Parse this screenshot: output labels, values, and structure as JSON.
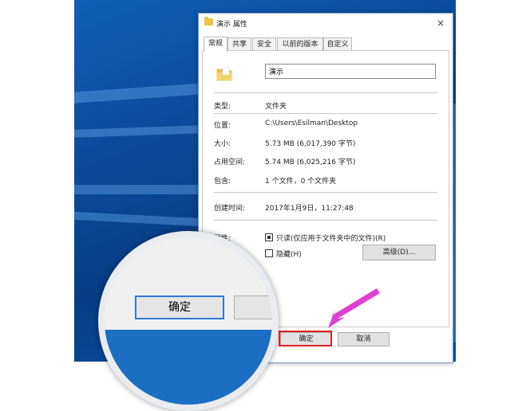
{
  "window": {
    "title": "演示 属性",
    "close_glyph": "×"
  },
  "tabs": [
    {
      "label": "常规"
    },
    {
      "label": "共享"
    },
    {
      "label": "安全"
    },
    {
      "label": "以前的版本"
    },
    {
      "label": "自定义"
    }
  ],
  "general": {
    "name_value": "演示",
    "rows": [
      {
        "label": "类型:",
        "value": "文件夹"
      },
      {
        "label": "位置:",
        "value": "C:\\Users\\Esilman\\Desktop"
      },
      {
        "label": "大小:",
        "value": "5.73 MB (6,017,390 字节)"
      },
      {
        "label": "占用空间:",
        "value": "5.74 MB (6,025,216 字节)"
      },
      {
        "label": "包含:",
        "value": "1 个文件，0 个文件夹"
      },
      {
        "label": "创建时间:",
        "value": "2017年1月9日，11:27:48"
      }
    ],
    "attributes": {
      "label": "属性:",
      "readonly_label": "只读(仅应用于文件夹中的文件)(R)",
      "hidden_label": "隐藏(H)",
      "advanced_label": "高级(D)..."
    }
  },
  "footer": {
    "ok_label": "确定",
    "cancel_label": "取消"
  },
  "magnifier": {
    "ok_label": "确定"
  },
  "colors": {
    "accent": "#2b7ad8",
    "highlight": "#e02020",
    "arrow": "#e040d0",
    "folder": "#e8c34b"
  }
}
